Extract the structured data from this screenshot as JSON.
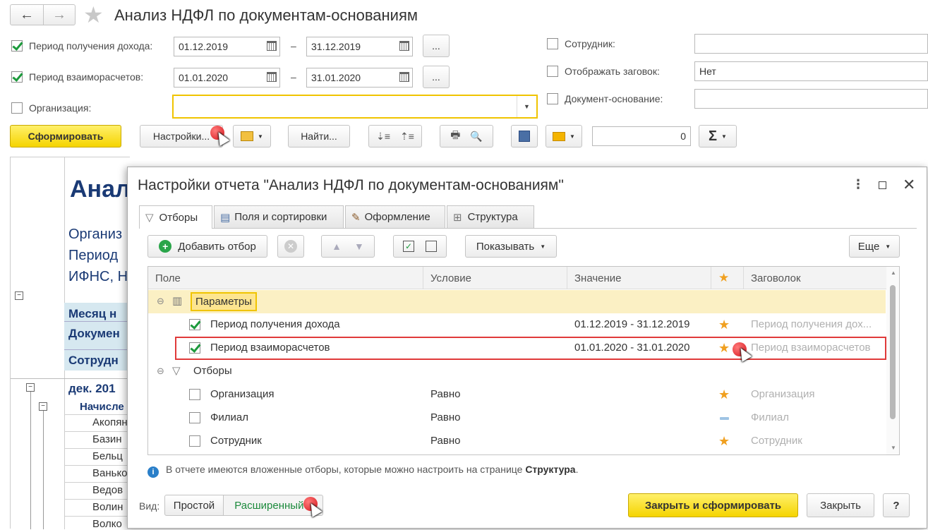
{
  "window": {
    "title": "Анализ НДФЛ по документам-основаниям",
    "back": "←",
    "forward": "→",
    "star": "★"
  },
  "filters": {
    "income_period_label": "Период получения дохода:",
    "income_from": "01.12.2019",
    "income_to": "31.12.2019",
    "settlement_period_label": "Период взаиморасчетов:",
    "settlement_from": "01.01.2020",
    "settlement_to": "31.01.2020",
    "dash": "–",
    "ellipsis": "...",
    "organization_label": "Организация:",
    "organization_value": "",
    "employee_label": "Сотрудник:",
    "employee_value": "",
    "show_header_label": "Отображать заговок:",
    "show_header_value": "Нет",
    "base_doc_label": "Документ-основание:",
    "base_doc_value": ""
  },
  "toolbar": {
    "generate": "Сформировать",
    "settings": "Настройки...",
    "find": "Найти...",
    "sum_value": "0",
    "sigma": "Σ"
  },
  "report_bg": {
    "title_partial": "Анал",
    "org_partial": "Организ",
    "period_partial": "Период",
    "ifns_partial": "ИФНС, Н",
    "month_partial": "Месяц н",
    "doc_partial": "Докумен",
    "employee_partial": "Сотрудн",
    "dec_partial": "дек. 201",
    "accrual_partial": "Начисле",
    "names": [
      "Акопян",
      "Базин",
      "Бельц",
      "Ванько",
      "Ведов",
      "Волин",
      "Волко"
    ]
  },
  "dialog": {
    "title": "Настройки отчета \"Анализ НДФЛ по документам-основаниям\"",
    "tabs": [
      "Отборы",
      "Поля и сортировки",
      "Оформление",
      "Структура"
    ],
    "add_filter": "Добавить отбор",
    "show": "Показывать",
    "more": "Еще",
    "columns": {
      "field": "Поле",
      "condition": "Условие",
      "value": "Значение",
      "header": "Заговолок"
    },
    "rows": [
      {
        "field": "Параметры",
        "condition": "",
        "value": "",
        "header": ""
      },
      {
        "field": "Период получения дохода",
        "condition": "",
        "value": "01.12.2019 - 31.12.2019",
        "header": "Период получения дох..."
      },
      {
        "field": "Период взаиморасчетов",
        "condition": "",
        "value": "01.01.2020 - 31.01.2020",
        "header": "Период взаиморасчетов"
      },
      {
        "field": "Отборы",
        "condition": "",
        "value": "",
        "header": ""
      },
      {
        "field": "Организация",
        "condition": "Равно",
        "value": "",
        "header": "Организация"
      },
      {
        "field": "Филиал",
        "condition": "Равно",
        "value": "",
        "header": "Филиал"
      },
      {
        "field": "Сотрудник",
        "condition": "Равно",
        "value": "",
        "header": "Сотрудник"
      }
    ],
    "info_text": "В отчете имеются вложенные отборы, которые можно настроить на странице ",
    "info_link": "Структура",
    "info_end": ".",
    "view_label": "Вид:",
    "view_simple": "Простой",
    "view_extended": "Расширенный",
    "close_generate": "Закрыть и сформировать",
    "close": "Закрыть",
    "help": "?"
  }
}
